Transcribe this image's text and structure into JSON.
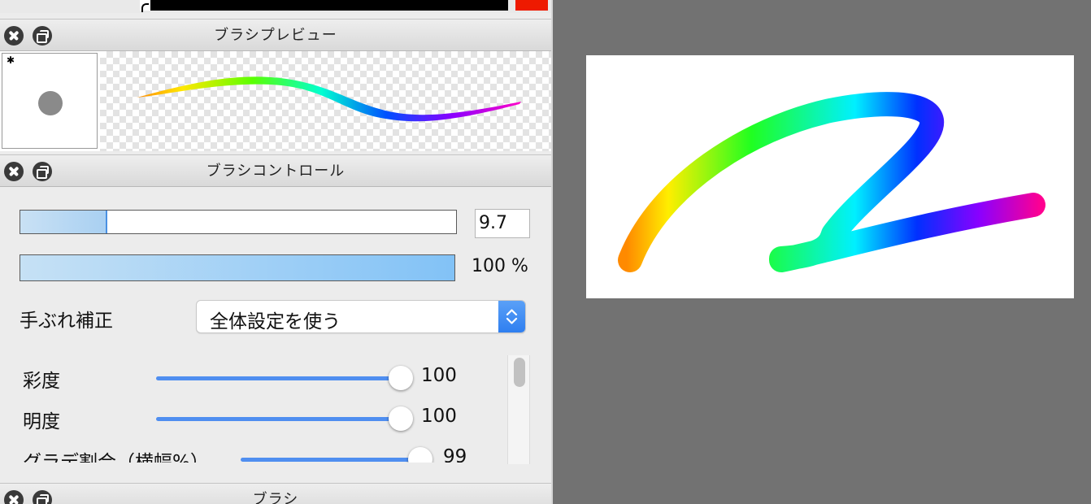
{
  "colors": {
    "slider_track": "#4f8ef0",
    "accent_select": "#2f7ff0",
    "current_color": "#ee1a00",
    "panel_bg": "#ececec",
    "workspace_bg": "#727272"
  },
  "icons": {
    "close": "close-icon",
    "float": "float-window-icon",
    "select_arrows": "chevron-updown-icon"
  },
  "panels": {
    "preview": {
      "title": "ブラシプレビュー",
      "tip_marker": "✱"
    },
    "control": {
      "title": "ブラシコントロール",
      "size": {
        "value": "9.7",
        "level": 0.2
      },
      "opacity": {
        "value_label": "100 %",
        "level": 1.0
      },
      "stabilizer": {
        "label": "手ぶれ補正",
        "selected": "全体設定を使う"
      },
      "sliders": [
        {
          "label": "彩度",
          "value": "100"
        },
        {
          "label": "明度",
          "value": "100"
        },
        {
          "label": "グラデ割合（横幅%）",
          "value": "99"
        }
      ]
    },
    "brush": {
      "title": "ブラシ"
    }
  }
}
